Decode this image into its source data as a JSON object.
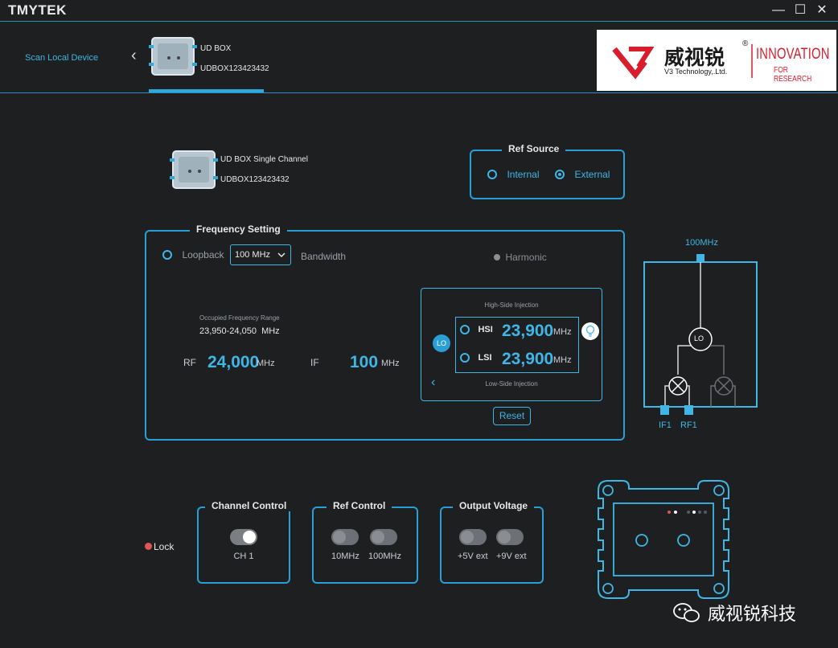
{
  "app": {
    "brand": "TMYTEK"
  },
  "window": {
    "minimize": "—",
    "maximize": "☐",
    "close": "✕"
  },
  "nav": {
    "scan_label": "Scan Local Device",
    "back": "‹"
  },
  "device_tab": {
    "name": "UD BOX",
    "serial": "UDBOX123423432"
  },
  "logo": {
    "chinese": "威视锐",
    "reg": "®",
    "english": "V3 Technology,.Ltd.",
    "slogan_1": "INNOVATION",
    "slogan_2": "FOR RESEARCH"
  },
  "device_info": {
    "name": "UD BOX Single Channel",
    "serial": "UDBOX123423432"
  },
  "ref_source": {
    "title": "Ref Source",
    "options": [
      "Internal",
      "External"
    ],
    "selected": "External"
  },
  "frequency": {
    "title": "Frequency Setting",
    "loopback": "Loopback",
    "bandwidth_value": "100 MHz",
    "bandwidth_label": "Bandwidth",
    "harmonic": "Harmonic",
    "occupied_label": "Occupied Frequency Range",
    "occupied_value": "23,950-24,050",
    "occupied_unit": "MHz",
    "rf_label": "RF",
    "rf_value": "24,000",
    "rf_unit": "MHz",
    "if_label": "IF",
    "if_value": "100",
    "if_unit": "MHz",
    "lo_badge": "LO",
    "high_side": "High-Side Injection",
    "low_side": "Low-Side Injection",
    "hsi_label": "HSI",
    "hsi_value": "23,900",
    "hsi_unit": "MHz",
    "lsi_label": "LSI",
    "lsi_value": "23,900",
    "lsi_unit": "MHz",
    "reset": "Reset"
  },
  "diagram": {
    "ref_label": "100MHz",
    "lo": "LO",
    "if1": "IF1",
    "rf1": "RF1"
  },
  "lock": {
    "label": "Lock",
    "color": "#e05555"
  },
  "channel_control": {
    "title": "Channel Control",
    "toggles": [
      {
        "label": "CH 1",
        "on": true
      }
    ]
  },
  "ref_control": {
    "title": "Ref Control",
    "toggles": [
      {
        "label": "10MHz",
        "on": false
      },
      {
        "label": "100MHz",
        "on": false
      }
    ]
  },
  "output_voltage": {
    "title": "Output Voltage",
    "toggles": [
      {
        "label": "+5V ext",
        "on": false
      },
      {
        "label": "+9V ext",
        "on": false
      }
    ]
  },
  "watermark": {
    "text": "威视锐科技"
  },
  "colors": {
    "accent": "#3fb6e6",
    "background": "#1e1f21",
    "lock": "#e05555"
  }
}
